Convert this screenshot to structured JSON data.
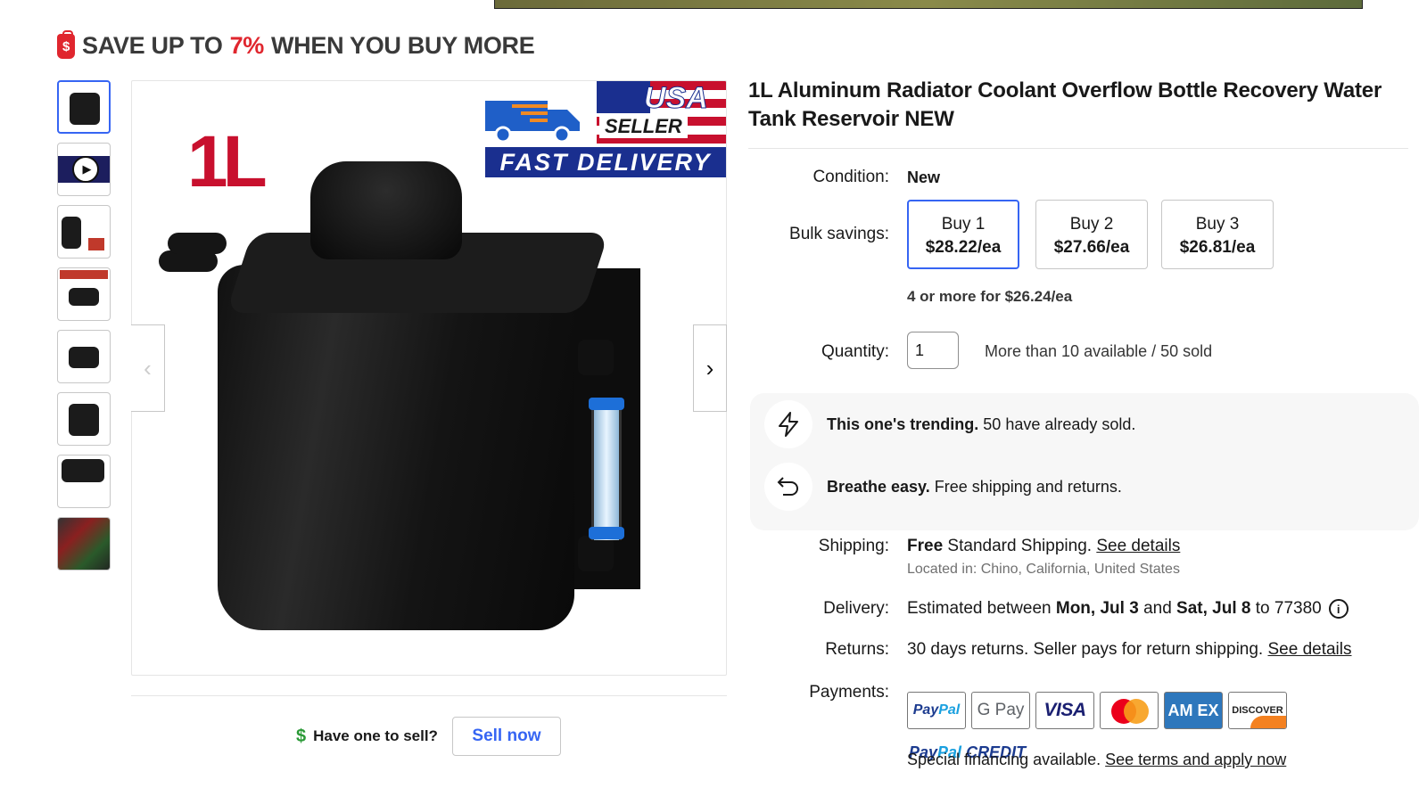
{
  "promo": {
    "prefix": "SAVE UP TO ",
    "pct": "7%",
    "suffix": " WHEN YOU BUY MORE"
  },
  "gallery": {
    "image_overlay": {
      "size_label": "1L",
      "badge_country": "USA",
      "badge_seller": "SELLER",
      "badge_delivery": "FAST DELIVERY"
    },
    "thumb_count": 8,
    "prev_glyph": "‹",
    "next_glyph": "›"
  },
  "sell": {
    "prompt": "Have one to sell?",
    "button": "Sell now",
    "icon": "dollar-icon"
  },
  "item": {
    "title": "1L Aluminum Radiator Coolant Overflow Bottle Recovery Water Tank Reservoir NEW",
    "condition_label": "Condition:",
    "condition_value": "New",
    "bulk_label": "Bulk savings:",
    "bulk_options": [
      {
        "label": "Buy 1",
        "price": "$28.22/ea"
      },
      {
        "label": "Buy 2",
        "price": "$27.66/ea"
      },
      {
        "label": "Buy 3",
        "price": "$26.81/ea"
      }
    ],
    "bulk_more": "4 or more for $26.24/ea",
    "quantity_label": "Quantity:",
    "quantity_value": "1",
    "availability": "More than 10 available / 50 sold"
  },
  "signals": [
    {
      "icon": "lightning-icon",
      "bold": "This one's trending.",
      "text": " 50 have already sold."
    },
    {
      "icon": "return-arrow-icon",
      "bold": "Breathe easy.",
      "text": " Free shipping and returns."
    }
  ],
  "shipping": {
    "label": "Shipping:",
    "free": "Free",
    "text": " Standard Shipping. ",
    "link": "See details",
    "location": "Located in: Chino, California, United States"
  },
  "delivery": {
    "label": "Delivery:",
    "pre": "Estimated between ",
    "date1": "Mon, Jul 3",
    "mid": " and ",
    "date2": "Sat, Jul 8",
    "post": " to 77380"
  },
  "returns": {
    "label": "Returns:",
    "text": "30 days returns. Seller pays for return shipping. ",
    "link": "See details"
  },
  "payments": {
    "label": "Payments:",
    "methods": [
      "PayPal",
      "G Pay",
      "VISA",
      "Mastercard",
      "AM EX",
      "DISCOVER"
    ],
    "credit_pay": "Pay",
    "credit_pal": "Pal",
    "credit_word": " CREDIT",
    "financing_text": "Special financing available. ",
    "financing_link": "See terms and apply now"
  }
}
